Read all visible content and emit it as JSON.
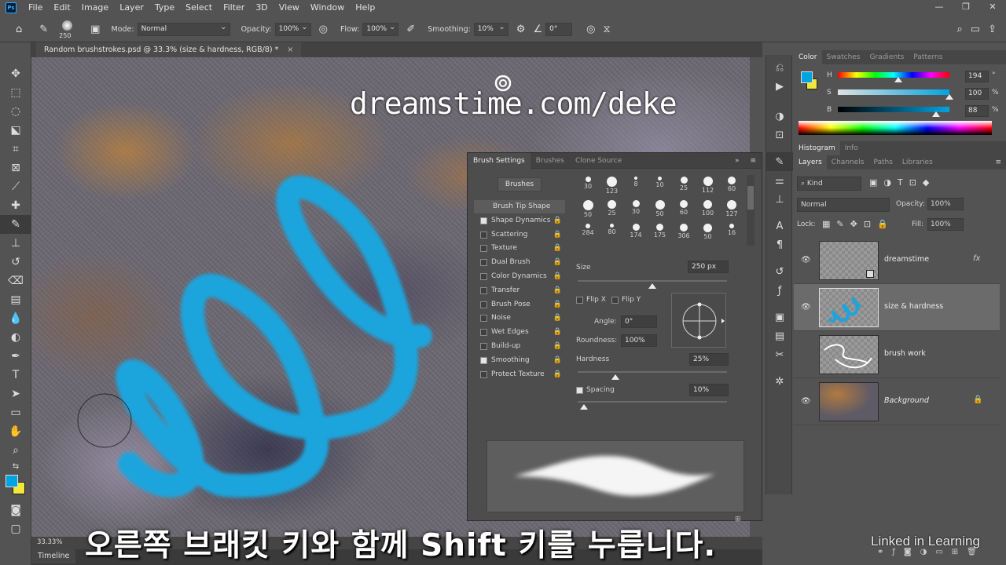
{
  "app": {
    "logo": "Ps"
  },
  "menu": [
    "File",
    "Edit",
    "Image",
    "Layer",
    "Type",
    "Select",
    "Filter",
    "3D",
    "View",
    "Window",
    "Help"
  ],
  "window_controls": [
    "—",
    "❐",
    "✕"
  ],
  "options": {
    "brush_size": "250",
    "mode_label": "Mode:",
    "mode_value": "Normal",
    "opacity_label": "Opacity:",
    "opacity_value": "100%",
    "flow_label": "Flow:",
    "flow_value": "100%",
    "smoothing_label": "Smoothing:",
    "smoothing_value": "10%",
    "angle_value": "0°"
  },
  "document": {
    "tab_title": "Random brushstrokes.psd @ 33.3% (size & hardness, RGB/8) *",
    "zoom": "33.33%",
    "watermark": "dreamstime.com/deke"
  },
  "timeline_label": "Timeline",
  "caption": "오른쪽 브래킷 키와 함께 Shift 키를 누릅니다.",
  "branding": "Linked in Learning",
  "brush_settings": {
    "tabs": [
      "Brush Settings",
      "Brushes",
      "Clone Source"
    ],
    "brushes_button": "Brushes",
    "options": [
      {
        "label": "Brush Tip Shape",
        "checked": null,
        "lock": false
      },
      {
        "label": "Shape Dynamics",
        "checked": true,
        "lock": true
      },
      {
        "label": "Scattering",
        "checked": false,
        "lock": true
      },
      {
        "label": "Texture",
        "checked": false,
        "lock": true
      },
      {
        "label": "Dual Brush",
        "checked": false,
        "lock": true
      },
      {
        "label": "Color Dynamics",
        "checked": false,
        "lock": true
      },
      {
        "label": "Transfer",
        "checked": false,
        "lock": true
      },
      {
        "label": "Brush Pose",
        "checked": false,
        "lock": true
      },
      {
        "label": "Noise",
        "checked": false,
        "lock": true
      },
      {
        "label": "Wet Edges",
        "checked": false,
        "lock": true
      },
      {
        "label": "Build-up",
        "checked": false,
        "lock": true
      },
      {
        "label": "Smoothing",
        "checked": true,
        "lock": true
      },
      {
        "label": "Protect Texture",
        "checked": false,
        "lock": true
      }
    ],
    "presets": [
      "30",
      "123",
      "8",
      "10",
      "25",
      "112",
      "60",
      "50",
      "25",
      "30",
      "50",
      "60",
      "100",
      "127",
      "284",
      "80",
      "174",
      "175",
      "306",
      "50",
      "16"
    ],
    "size_label": "Size",
    "size_value": "250 px",
    "flip_x": "Flip X",
    "flip_y": "Flip Y",
    "angle_label": "Angle:",
    "angle_value": "0°",
    "roundness_label": "Roundness:",
    "roundness_value": "100%",
    "hardness_label": "Hardness",
    "hardness_value": "25%",
    "spacing_label": "Spacing",
    "spacing_value": "10%",
    "size_fraction": 0.5,
    "hardness_fraction": 0.25,
    "spacing_fraction": 0.04
  },
  "color_panel": {
    "tabs": [
      "Color",
      "Swatches",
      "Gradients",
      "Patterns"
    ],
    "channels": [
      {
        "label": "H",
        "value": "194",
        "unit": "°"
      },
      {
        "label": "S",
        "value": "100",
        "unit": "%"
      },
      {
        "label": "B",
        "value": "88",
        "unit": "%"
      }
    ],
    "foreground": "#00a4e0",
    "background": "#f5e63c"
  },
  "histogram_tabs": [
    "Histogram",
    "Info"
  ],
  "layers_panel": {
    "tabs": [
      "Layers",
      "Channels",
      "Paths",
      "Libraries"
    ],
    "kind_label": "Kind",
    "blend_mode": "Normal",
    "opacity_label": "Opacity:",
    "opacity_value": "100%",
    "lock_label": "Lock:",
    "fill_label": "Fill:",
    "fill_value": "100%",
    "layers": [
      {
        "name": "dreamstime",
        "visible": true,
        "selected": false,
        "fx": "fx"
      },
      {
        "name": "size & hardness",
        "visible": true,
        "selected": true
      },
      {
        "name": "brush work",
        "visible": false,
        "selected": false
      },
      {
        "name": "Background",
        "visible": true,
        "selected": false,
        "locked": true
      }
    ]
  }
}
